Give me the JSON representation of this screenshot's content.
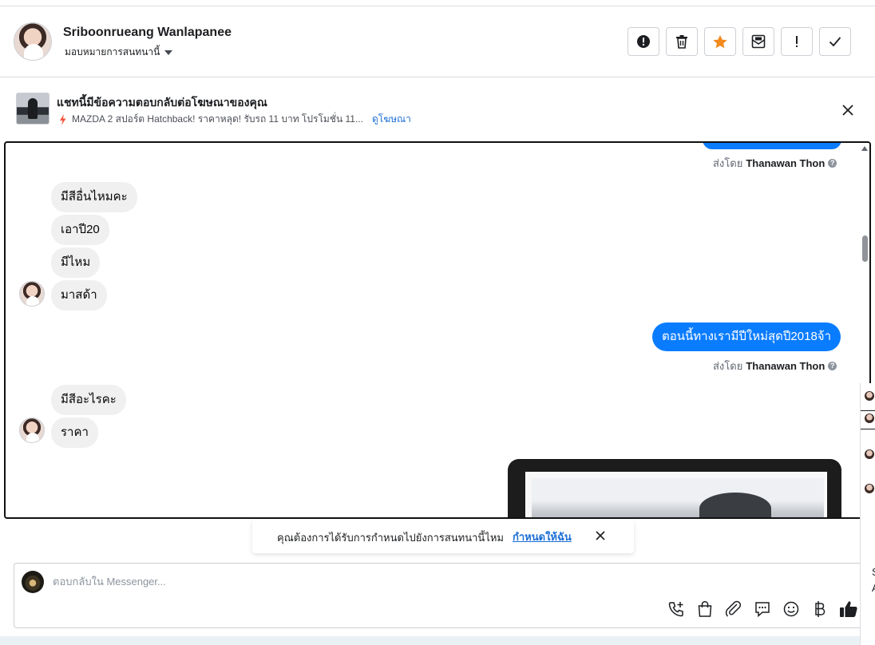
{
  "header": {
    "contact_name": "Sriboonrueang Wanlapanee",
    "assign_label": "มอบหมายการสนทนานี้",
    "actions": [
      {
        "name": "report-spam-button",
        "icon": "exclamation-circle-icon"
      },
      {
        "name": "delete-button",
        "icon": "trash-icon"
      },
      {
        "name": "star-button",
        "icon": "star-icon",
        "color": "#f28a1d"
      },
      {
        "name": "mark-unread-button",
        "icon": "envelope-icon"
      },
      {
        "name": "follow-up-button",
        "icon": "exclamation-icon"
      },
      {
        "name": "mark-done-button",
        "icon": "check-icon"
      }
    ]
  },
  "ad_banner": {
    "title": "แชทนี้มีข้อความตอบกลับต่อโฆษณาของคุณ",
    "ad_text": "MAZDA 2 สปอร์ต Hatchback! ราคาหลุด! รับรถ 11 บาท โปรโมชั่น 11...",
    "view_ad_link": "ดูโฆษณา"
  },
  "thread": {
    "sender_prefix": "ส่งโดย",
    "agent_name": "Thanawan Thon",
    "incoming_group_1": [
      "มีสีอื่นไหมคะ",
      "เอาปี20",
      "มีไหม",
      "มาสด้า"
    ],
    "outgoing_1": "ตอนนี้ทางเรามีปีใหม่สุดปี2018จ้า",
    "incoming_group_2": [
      "มีสีอะไรคะ",
      "ราคา"
    ]
  },
  "assign_toast": {
    "text": "คุณต้องการได้รับการกำหนดไปยังการสนทนานี้ไหม",
    "link": "กำหนดให้ฉัน"
  },
  "composer": {
    "placeholder": "ตอบกลับใน Messenger...",
    "tools": [
      "call-icon",
      "shopping-bag-icon",
      "paperclip-icon",
      "saved-reply-icon",
      "emoji-icon",
      "baht-icon",
      "thumbs-up-icon"
    ]
  },
  "right_edge": {
    "letter_1": "S",
    "letter_2": "A"
  },
  "colors": {
    "accent_blue": "#0a7cff",
    "link_blue": "#1d6fd6",
    "star_orange": "#f28a1d",
    "bolt_orange": "#f5533d"
  }
}
